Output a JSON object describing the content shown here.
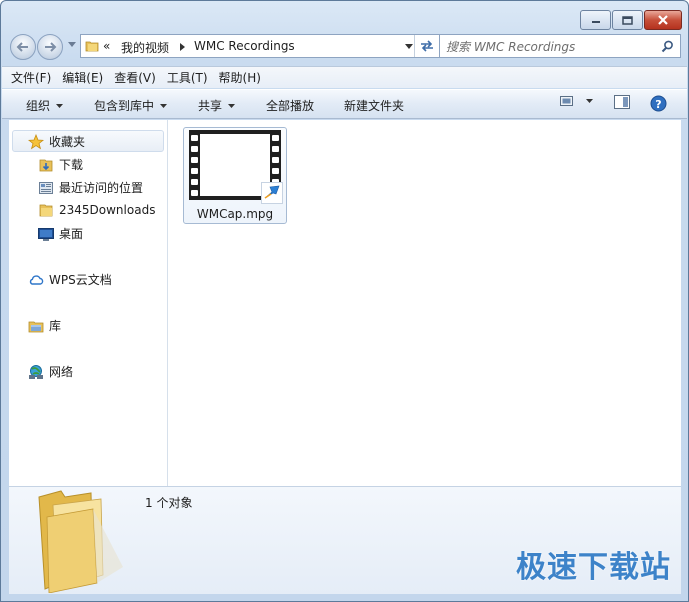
{
  "window": {
    "caption": {
      "minimize": "minimize",
      "maximize": "maximize",
      "close": "close"
    }
  },
  "address": {
    "more": "«",
    "crumbs": [
      "我的视频",
      "WMC Recordings"
    ]
  },
  "search": {
    "placeholder": "搜索 WMC Recordings"
  },
  "menu": {
    "items": [
      "文件(F)",
      "编辑(E)",
      "查看(V)",
      "工具(T)",
      "帮助(H)"
    ]
  },
  "toolbar": {
    "organize": "组织",
    "include_in_library": "包含到库中",
    "share": "共享",
    "play_all": "全部播放",
    "new_folder": "新建文件夹"
  },
  "sidebar": {
    "favorites": "收藏夹",
    "favorites_items": [
      "下载",
      "最近访问的位置",
      "2345Downloads",
      "桌面"
    ],
    "wps": "WPS云文档",
    "library": "库",
    "network": "网络"
  },
  "files": [
    {
      "name": "WMCap.mpg"
    }
  ],
  "status": {
    "count": "1 个对象"
  },
  "watermark": "极速下载站",
  "colors": {
    "accent": "#3d83c9",
    "close": "#c7503a"
  }
}
